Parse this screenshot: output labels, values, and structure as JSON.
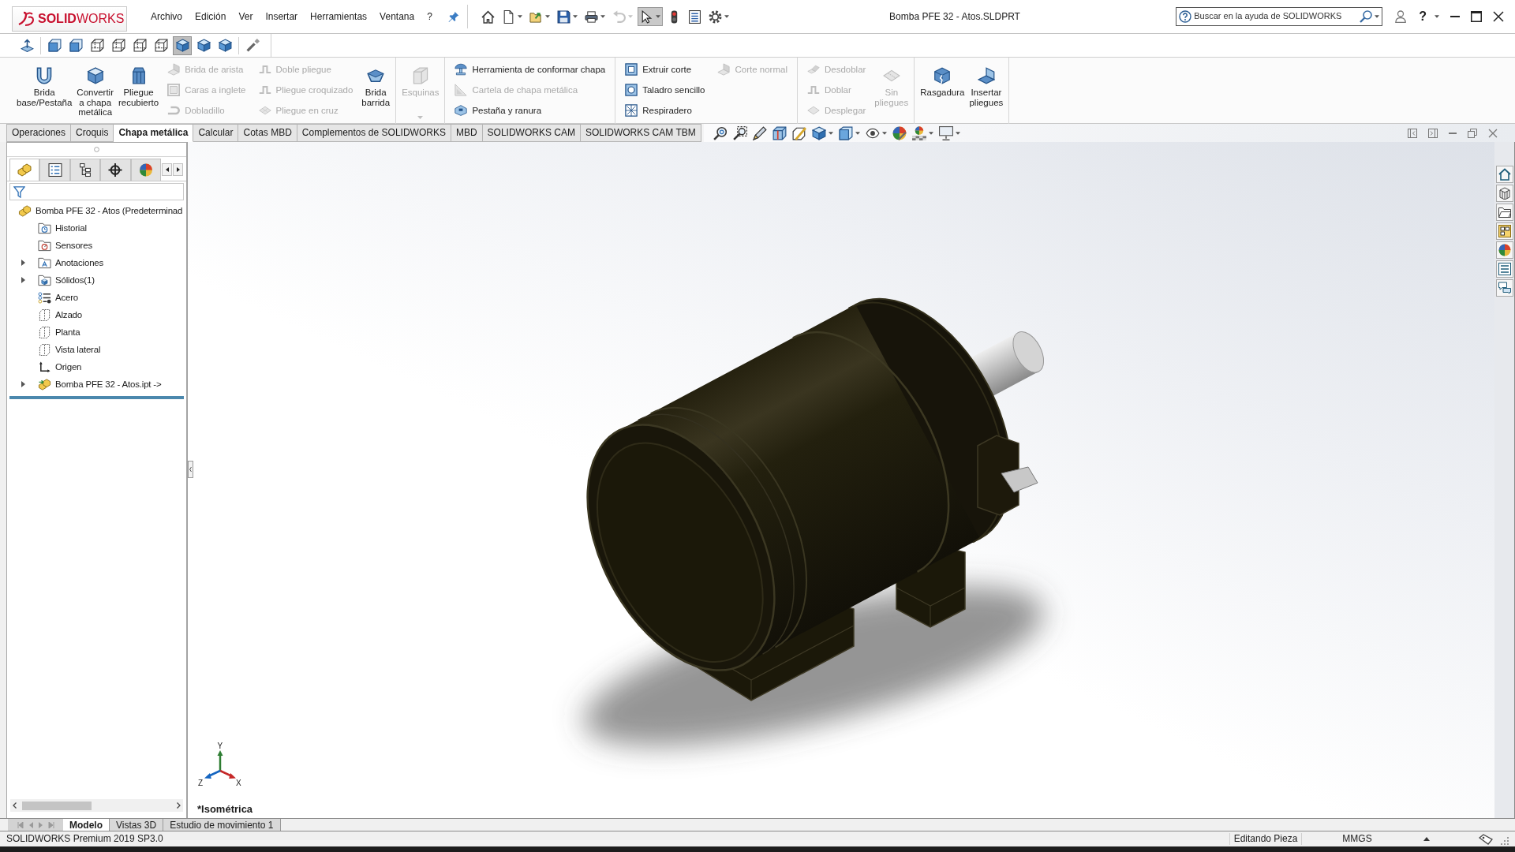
{
  "window": {
    "logo": "**SOLID**WORKS",
    "title": "Bomba PFE 32 - Atos.SLDPRT",
    "help": "?"
  },
  "menu": [
    {
      "label": "Archivo"
    },
    {
      "label": "Edición"
    },
    {
      "label": "Ver"
    },
    {
      "label": "Insertar"
    },
    {
      "label": "Herramientas"
    },
    {
      "label": "Ventana"
    },
    {
      "label": "?"
    }
  ],
  "quick_access": [
    {
      "kind": "home",
      "dropdown": false,
      "disabled": false,
      "selected": false
    },
    {
      "kind": "new",
      "dropdown": true,
      "disabled": false,
      "selected": false
    },
    {
      "kind": "open",
      "dropdown": true,
      "disabled": false,
      "selected": false
    },
    {
      "kind": "save",
      "dropdown": true,
      "disabled": false,
      "selected": false
    },
    {
      "kind": "print",
      "dropdown": true,
      "disabled": false,
      "selected": false
    },
    {
      "kind": "undo",
      "dropdown": true,
      "disabled": true,
      "selected": false
    },
    {
      "kind": "select",
      "dropdown": true,
      "disabled": false,
      "selected": true
    },
    {
      "kind": "rebuild",
      "dropdown": false,
      "disabled": false,
      "selected": false
    },
    {
      "kind": "properties",
      "dropdown": false,
      "disabled": false,
      "selected": false
    },
    {
      "kind": "options",
      "dropdown": true,
      "disabled": false,
      "selected": false
    }
  ],
  "search": {
    "placeholder": "Buscar en la ayuda de SOLIDWORKS"
  },
  "view_toolbar": [
    {
      "kind": "normal-to",
      "selected": false
    },
    {
      "kind": "cube-face",
      "selected": false
    },
    {
      "kind": "cube-face",
      "selected": false
    },
    {
      "kind": "cube-wire",
      "selected": false
    },
    {
      "kind": "cube-wire",
      "selected": false
    },
    {
      "kind": "cube-wire",
      "selected": false
    },
    {
      "kind": "cube-wire",
      "selected": false
    },
    {
      "kind": "cube-solid",
      "selected": true
    },
    {
      "kind": "cube-solid",
      "selected": false
    },
    {
      "kind": "cube-solid",
      "selected": false
    },
    {
      "kind": "wand",
      "selected": false
    }
  ],
  "ribbon": {
    "groups": [
      {
        "columns": [
          {
            "kind": "large",
            "items": [
              {
                "label": "Brida\nbase/Pestaña",
                "disabled": false,
                "dropdown": false
              }
            ]
          },
          {
            "kind": "large",
            "items": [
              {
                "label": "Convertir\na chapa\nmetálica",
                "disabled": false,
                "dropdown": false
              }
            ]
          },
          {
            "kind": "large",
            "items": [
              {
                "label": "Pliegue\nrecubierto",
                "disabled": false,
                "dropdown": false
              }
            ]
          },
          {
            "kind": "stack",
            "items": [
              {
                "label": "Brida de arista",
                "disabled": true
              },
              {
                "label": "Caras a inglete",
                "disabled": true
              },
              {
                "label": "Dobladillo",
                "disabled": true
              }
            ]
          },
          {
            "kind": "stack",
            "items": [
              {
                "label": "Doble pliegue",
                "disabled": true
              },
              {
                "label": "Pliegue croquizado",
                "disabled": true
              },
              {
                "label": "Pliegue en cruz",
                "disabled": true
              }
            ]
          },
          {
            "kind": "large",
            "items": [
              {
                "label": "Brida\nbarrida",
                "disabled": false,
                "dropdown": false
              }
            ]
          }
        ]
      },
      {
        "columns": [
          {
            "kind": "large",
            "items": [
              {
                "label": "Esquinas",
                "disabled": true,
                "dropdown": true
              }
            ]
          }
        ]
      },
      {
        "columns": [
          {
            "kind": "stack",
            "items": [
              {
                "label": "Herramienta de conformar chapa",
                "disabled": false
              },
              {
                "label": "Cartela de chapa metálica",
                "disabled": true
              },
              {
                "label": "Pestaña y ranura",
                "disabled": false
              }
            ]
          }
        ]
      },
      {
        "columns": [
          {
            "kind": "stack",
            "items": [
              {
                "label": "Extruir corte",
                "disabled": false
              },
              {
                "label": "Taladro sencillo",
                "disabled": false
              },
              {
                "label": "Respiradero",
                "disabled": false
              }
            ]
          },
          {
            "kind": "stack",
            "items": [
              {
                "label": "Corte normal",
                "disabled": true
              }
            ]
          }
        ]
      },
      {
        "columns": [
          {
            "kind": "stack",
            "items": [
              {
                "label": "Desdoblar",
                "disabled": true
              },
              {
                "label": "Doblar",
                "disabled": true
              },
              {
                "label": "Desplegar",
                "disabled": true
              }
            ]
          },
          {
            "kind": "large",
            "items": [
              {
                "label": "Sin\npliegues",
                "disabled": true,
                "dropdown": false
              }
            ]
          }
        ]
      },
      {
        "columns": [
          {
            "kind": "large",
            "items": [
              {
                "label": "Rasgadura",
                "disabled": false,
                "dropdown": false
              }
            ]
          },
          {
            "kind": "large",
            "items": [
              {
                "label": "Insertar\npliegues",
                "disabled": false,
                "dropdown": false
              }
            ]
          }
        ]
      }
    ]
  },
  "command_tabs": [
    {
      "label": "Operaciones",
      "selected": false
    },
    {
      "label": "Croquis",
      "selected": false
    },
    {
      "label": "Chapa metálica",
      "selected": true
    },
    {
      "label": "Calcular",
      "selected": false
    },
    {
      "label": "Cotas MBD",
      "selected": false
    },
    {
      "label": "Complementos de SOLIDWORKS",
      "selected": false
    },
    {
      "label": "MBD",
      "selected": false
    },
    {
      "label": "SOLIDWORKS CAM",
      "selected": false
    },
    {
      "label": "SOLIDWORKS CAM TBM",
      "selected": false
    }
  ],
  "heads_up_toolbar": [
    {
      "kind": "zoom-fit",
      "dropdown": false
    },
    {
      "kind": "zoom-area",
      "dropdown": false
    },
    {
      "kind": "previous-view",
      "dropdown": false
    },
    {
      "kind": "section-view",
      "dropdown": false
    },
    {
      "kind": "dynamic-annotation",
      "dropdown": false
    },
    {
      "kind": "view-orientation",
      "dropdown": true
    },
    {
      "kind": "display-style",
      "dropdown": true
    },
    {
      "kind": "hide-show",
      "dropdown": true
    },
    {
      "kind": "edit-appearance",
      "dropdown": false
    },
    {
      "kind": "apply-scene",
      "dropdown": true
    },
    {
      "kind": "view-settings",
      "dropdown": true
    }
  ],
  "feature_manager": {
    "tabs": [
      {
        "kind": "feature-tree",
        "selected": true
      },
      {
        "kind": "property",
        "selected": false
      },
      {
        "kind": "configuration",
        "selected": false
      },
      {
        "kind": "dimxpert",
        "selected": false
      },
      {
        "kind": "display",
        "selected": false
      }
    ],
    "tree": {
      "label": "Bomba PFE 32 - Atos (Predeterminad",
      "kind": "part",
      "children": [
        {
          "label": "Historial",
          "kind": "history"
        },
        {
          "label": "Sensores",
          "kind": "sensors"
        },
        {
          "label": "Anotaciones",
          "kind": "annotations",
          "expanded": false
        },
        {
          "label": "Sólidos(1)",
          "kind": "solids",
          "expanded": false
        },
        {
          "label": "Acero",
          "kind": "material"
        },
        {
          "label": "Alzado",
          "kind": "plane"
        },
        {
          "label": "Planta",
          "kind": "plane"
        },
        {
          "label": "Vista lateral",
          "kind": "plane"
        },
        {
          "label": "Origen",
          "kind": "origin"
        },
        {
          "label": "Bomba PFE 32 - Atos.ipt ->",
          "kind": "derived-part",
          "expanded": false
        }
      ]
    }
  },
  "viewport": {
    "view_name": "*Isométrica",
    "triad": {
      "x": "X",
      "y": "Y",
      "z": "Z"
    }
  },
  "bottom_tabs": [
    {
      "label": "Modelo",
      "selected": true
    },
    {
      "label": "Vistas 3D",
      "selected": false
    },
    {
      "label": "Estudio de movimiento 1",
      "selected": false
    }
  ],
  "status_bar": {
    "product": "SOLIDWORKS Premium 2019 SP3.0",
    "mode": "Editando Pieza",
    "units": "MMGS"
  }
}
